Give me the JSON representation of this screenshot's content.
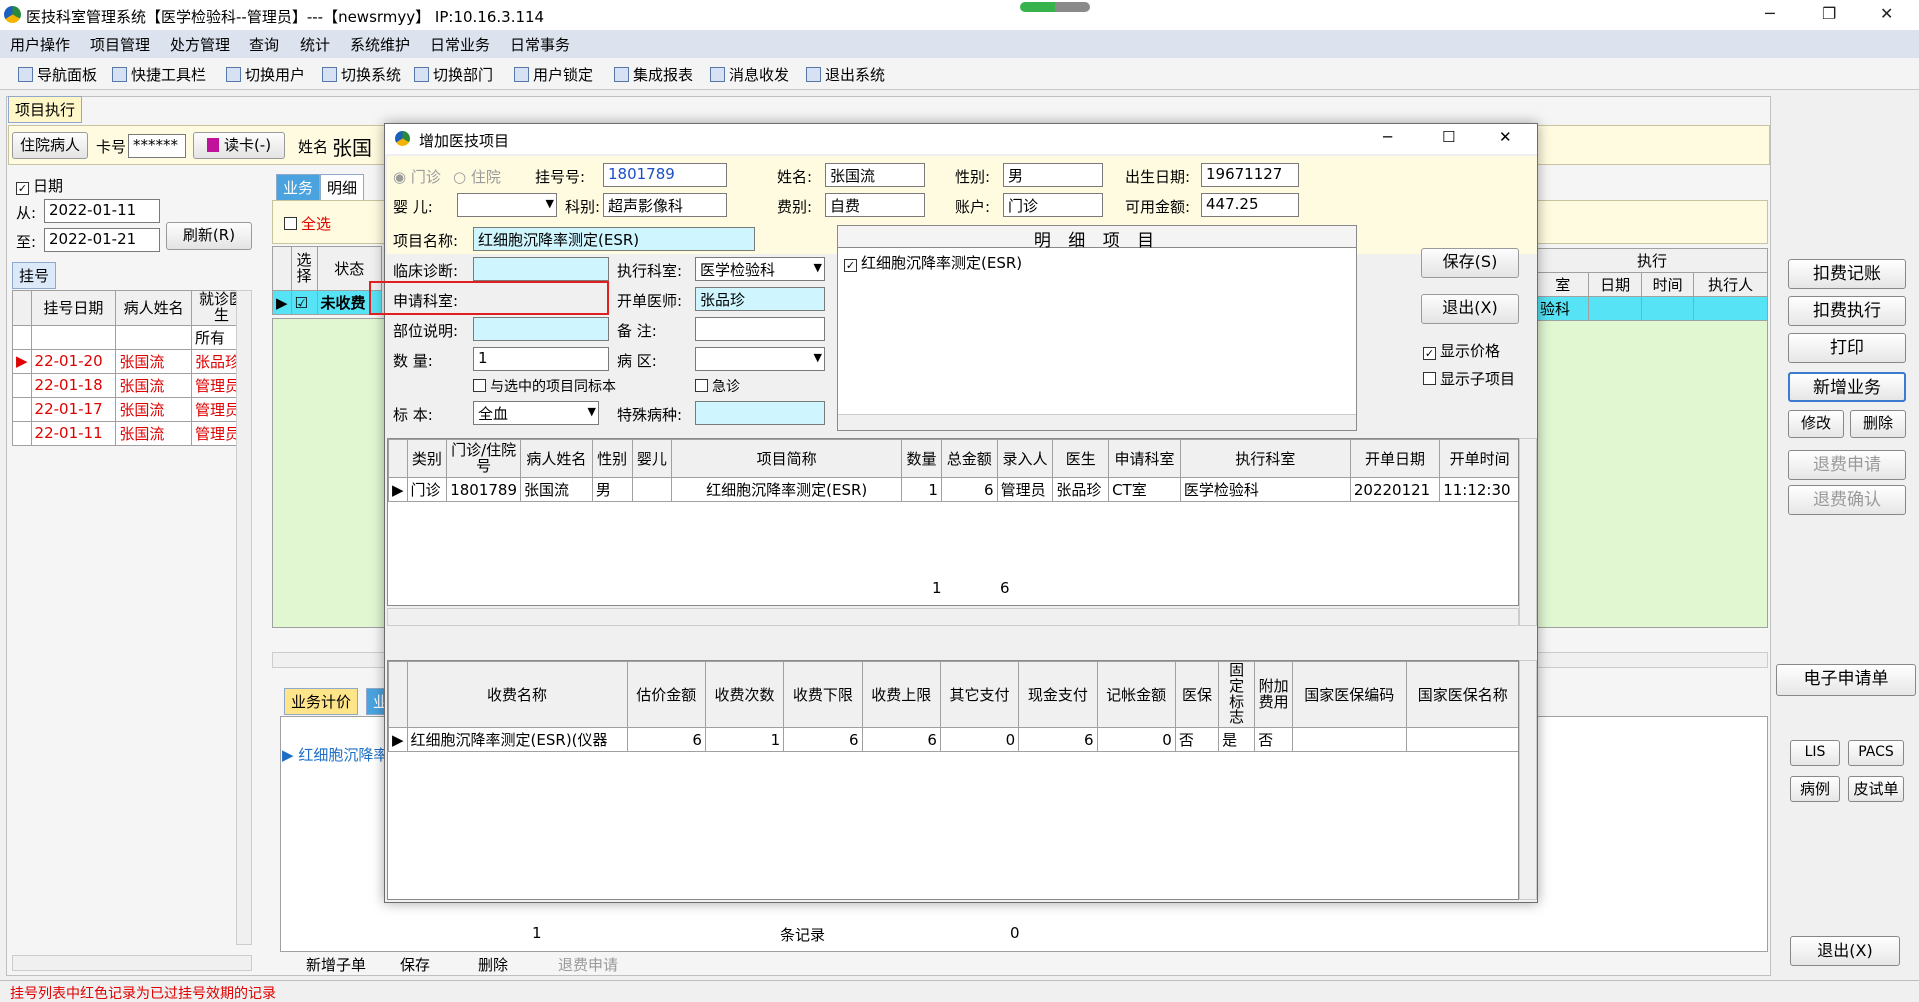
{
  "window": {
    "title": "医技科室管理系统【医学检验科--管理员】---【newsrmyy】 IP:10.16.3.114",
    "min": "─",
    "max": "❐",
    "close": "✕"
  },
  "menu": [
    "用户操作",
    "项目管理",
    "处方管理",
    "查询",
    "统计",
    "系统维护",
    "日常业务",
    "日常事务"
  ],
  "toolbar": [
    "导航面板",
    "快捷工具栏",
    "切换用户",
    "切换系统",
    "切换部门",
    "用户锁定",
    "集成报表",
    "消息收发",
    "退出系统"
  ],
  "main_tab": "项目执行",
  "patient_bar": {
    "inpatient_btn": "住院病人",
    "card_label": "卡号",
    "card_value": "******",
    "read_card_btn": "读卡(-)",
    "name_label": "姓名",
    "name_value": "张国"
  },
  "date_filter": {
    "date_check": "日期",
    "from_label": "从:",
    "from_value": "2022-01-11",
    "to_label": "至:",
    "to_value": "2022-01-21",
    "refresh_btn": "刷新(R)"
  },
  "reg_panel": {
    "tab": "挂号",
    "headers": [
      "挂号日期",
      "病人姓名",
      "就诊医生"
    ],
    "filter": "所有",
    "rows": [
      [
        "22-01-20",
        "张国流",
        "张品珍"
      ],
      [
        "22-01-18",
        "张国流",
        "管理员"
      ],
      [
        "22-01-17",
        "张国流",
        "管理员"
      ],
      [
        "22-01-11",
        "张国流",
        "管理员"
      ]
    ]
  },
  "biz": {
    "tabs": [
      "业务",
      "明细"
    ],
    "select_all": "全选",
    "col_select": "选择",
    "col_status": "状态",
    "row_status": "未收费",
    "exec_header": "执行",
    "exec_cols": [
      "室",
      "日期",
      "时间",
      "执行人"
    ],
    "exec_row": "验科"
  },
  "lower": {
    "tab1": "业务计价",
    "tab2": "业",
    "row1": "红细胞沉降率",
    "footer_count": "1",
    "footer_records": "条记录",
    "footer_zero": "0"
  },
  "bottom_buttons": [
    "新增子单",
    "保存",
    "删除",
    "退费申请"
  ],
  "right_panel": {
    "btns": [
      "扣费记账",
      "扣费执行",
      "打印",
      "新增业务"
    ],
    "edit": "修改",
    "delete": "删除",
    "refund_apply": "退费申请",
    "refund_confirm": "退费确认",
    "eform": "电子申请单",
    "lis": "LIS",
    "pacs": "PACS",
    "case": "病例",
    "skin": "皮试单",
    "exit": "退出(X)"
  },
  "status_text": "挂号列表中红色记录为已过挂号效期的记录",
  "dialog": {
    "title": "增加医技项目",
    "clinic": "门诊",
    "inpatient": "住院",
    "reg_no_label": "挂号号:",
    "reg_no": "1801789",
    "name_label": "姓名:",
    "name": "张国流",
    "sex_label": "性别:",
    "sex": "男",
    "birth_label": "出生日期:",
    "birth": "19671127",
    "infant_label": "婴 儿:",
    "infant": "",
    "dept_label": "科别:",
    "dept": "超声影像科",
    "fee_type_label": "费别:",
    "fee_type": "自费",
    "account_label": "账户:",
    "account": "门诊",
    "balance_label": "可用金额:",
    "balance": "447.25",
    "item_name_label": "项目名称:",
    "item_name": "红细胞沉降率测定(ESR)",
    "diag_label": "临床诊断:",
    "diag": "",
    "exec_dept_label": "执行科室:",
    "exec_dept": "医学检验科",
    "apply_dept_label": "申请科室:",
    "apply_dept": "",
    "doctor_label": "开单医师:",
    "doctor": "张品珍",
    "part_label": "部位说明:",
    "part": "",
    "note_label": "备 注:",
    "note": "",
    "qty_label": "数 量:",
    "qty": "1",
    "ward_label": "病 区:",
    "ward": "",
    "same_sample": "与选中的项目同标本",
    "urgent": "急诊",
    "sample_label": "标 本:",
    "sample": "全血",
    "disease_label": "特殊病种:",
    "disease": "",
    "detail_header": "明 细 项 目",
    "detail_item": "红细胞沉降率测定(ESR)",
    "save_btn": "保存(S)",
    "exit_btn": "退出(X)",
    "show_price": "显示价格",
    "show_sub": "显示子项目",
    "grid_headers": [
      "类别",
      "门诊/住院号",
      "病人姓名",
      "性别",
      "婴儿",
      "项目简称",
      "数量",
      "总金额",
      "录入人",
      "医生",
      "申请科室",
      "执行科室",
      "开单日期",
      "开单时间"
    ],
    "grid_row": [
      "门诊",
      "1801789",
      "张国流",
      "男",
      "",
      "红细胞沉降率测定(ESR)",
      "1",
      "6",
      "管理员",
      "张品珍",
      "CT室",
      "医学检验科",
      "20220121",
      "11:12:30"
    ],
    "grid_footer_qty": "1",
    "grid_footer_total": "6",
    "fee_headers": [
      "收费名称",
      "估价金额",
      "收费次数",
      "收费下限",
      "收费上限",
      "其它支付",
      "现金支付",
      "记帐金额",
      "医保",
      "固定标志",
      "附加费用",
      "国家医保编码",
      "国家医保名称"
    ],
    "fee_row": [
      "红细胞沉降率测定(ESR)(仪器",
      "6",
      "1",
      "6",
      "6",
      "0",
      "6",
      "0",
      "否",
      "是",
      "否",
      "",
      ""
    ]
  }
}
